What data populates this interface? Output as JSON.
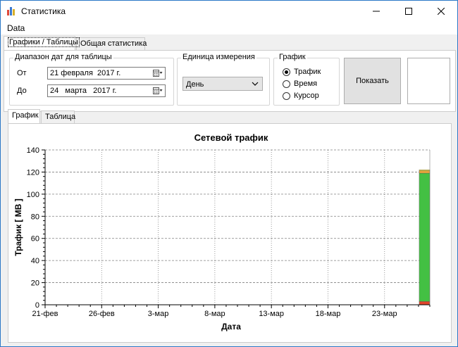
{
  "window": {
    "title": "Статистика"
  },
  "menu": {
    "items": [
      "Data"
    ]
  },
  "main_tabs": [
    {
      "label": "Графики / Таблицы",
      "active": true
    },
    {
      "label": "Общая статистика",
      "active": false
    }
  ],
  "date_range": {
    "group_title": "Диапазон дат для таблицы",
    "from_label": "От",
    "from_value": "21 февраля  2017 г.",
    "to_label": "До",
    "to_value": "24   марта   2017 г."
  },
  "unit": {
    "group_title": "Единица измерения",
    "selected": "День"
  },
  "graph_type": {
    "group_title": "График",
    "options": [
      {
        "label": "Трафик",
        "checked": true
      },
      {
        "label": "Время",
        "checked": false
      },
      {
        "label": "Курсор",
        "checked": false
      }
    ]
  },
  "show_button": {
    "label": "Показать"
  },
  "sub_tabs": [
    {
      "label": "График",
      "active": true
    },
    {
      "label": "Таблица",
      "active": false
    }
  ],
  "chart_data": {
    "type": "bar",
    "title": "Сетевой трафик",
    "xlabel": "Дата",
    "ylabel": "Трафик [ МВ ]",
    "ylim": [
      0,
      140
    ],
    "yticks": [
      0,
      20,
      40,
      60,
      80,
      100,
      120,
      140
    ],
    "x_tick_labels": [
      "21-фев",
      "26-фев",
      "3-мар",
      "8-мар",
      "13-мар",
      "18-мар",
      "23-мар"
    ],
    "grid": true,
    "stacked": true,
    "bars": [
      {
        "category": "24-мар",
        "segments": [
          {
            "value": 3,
            "color": "#e0452b"
          },
          {
            "value": 116,
            "color": "#43c043"
          },
          {
            "value": 2,
            "color": "#f0a93a"
          },
          {
            "value": 1,
            "color": "#f4dd3a"
          }
        ]
      }
    ],
    "colors": {
      "axis": "#000000",
      "grid": "#808080"
    }
  }
}
